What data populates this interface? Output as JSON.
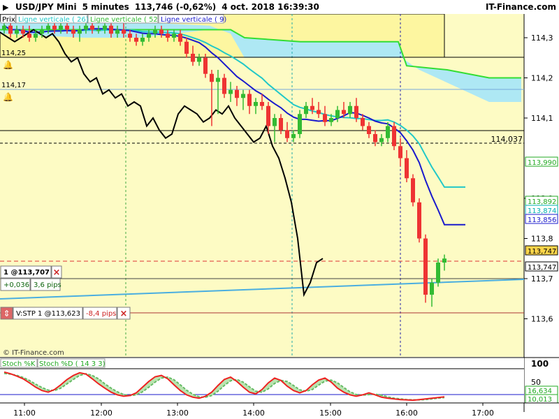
{
  "header": {
    "title": "USD/JPY Mini",
    "interval": "5 minutes",
    "quote": "113,746 (-0,62%)",
    "datetime": "4 oct. 2018 16:39:30",
    "brand": "IT-Finance.com"
  },
  "legend": {
    "price": "Prix",
    "line26": "Ligne verticale ( 26)",
    "line52": "Ligne verticale ( 52)",
    "line9": "Ligne verticale ( 9)"
  },
  "watermark": "© IT-Finance.com",
  "levels": {
    "alert_upper": "114,25",
    "alert_lower": "114,17",
    "dashed_level": "114,037"
  },
  "right_axis": {
    "ticks": [
      "114,3",
      "114,2",
      "114,1",
      "113,9",
      "113,8",
      "113,7",
      "113,6"
    ],
    "tags": [
      {
        "text": "113,990",
        "color": "#22aa22"
      },
      {
        "text": "113,892",
        "color": "#22aa22"
      },
      {
        "text": "113,874",
        "color": "#00b0b0"
      },
      {
        "text": "113,856",
        "color": "#1a1acc"
      },
      {
        "text": "113,747",
        "color": "#000000"
      },
      {
        "text": "113,747",
        "color": "#000000"
      }
    ]
  },
  "position": {
    "label": "1 @113,707",
    "gain": "+0,036",
    "pips": "3,6 pips",
    "close_icon": "×"
  },
  "stop": {
    "label": "V:STP  1 @113,623",
    "pips": "-8,4 pips",
    "close_icon": "×",
    "arrow_icon": "⇕"
  },
  "stoch": {
    "label_k": "Stoch %K",
    "label_d": "Stoch %D ( 14 3 3)",
    "ticks": [
      "100",
      "50"
    ],
    "tags": [
      {
        "text": "16,634",
        "color": "#22aa22"
      },
      {
        "text": "10,013",
        "color": "#22aa22"
      }
    ]
  },
  "x_axis": [
    "11:00",
    "12:00",
    "13:00",
    "14:00",
    "15:00",
    "16:00",
    "17:00"
  ],
  "chart_data": {
    "type": "candlestick",
    "ylim": [
      113.55,
      114.35
    ],
    "stoch_ylim": [
      0,
      100
    ],
    "x_labels": [
      "11:00",
      "12:00",
      "13:00",
      "14:00",
      "15:00",
      "16:00",
      "17:00"
    ],
    "candles": [
      [
        114.32,
        114.34,
        114.31,
        114.33
      ],
      [
        114.33,
        114.34,
        114.3,
        114.31
      ],
      [
        114.31,
        114.33,
        114.3,
        114.32
      ],
      [
        114.32,
        114.33,
        114.3,
        114.31
      ],
      [
        114.31,
        114.33,
        114.29,
        114.3
      ],
      [
        114.3,
        114.32,
        114.29,
        114.31
      ],
      [
        114.31,
        114.33,
        114.3,
        114.32
      ],
      [
        114.32,
        114.34,
        114.31,
        114.33
      ],
      [
        114.33,
        114.34,
        114.31,
        114.32
      ],
      [
        114.32,
        114.34,
        114.31,
        114.33
      ],
      [
        114.33,
        114.34,
        114.31,
        114.32
      ],
      [
        114.32,
        114.33,
        114.3,
        114.31
      ],
      [
        114.31,
        114.33,
        114.29,
        114.32
      ],
      [
        114.32,
        114.34,
        114.31,
        114.33
      ],
      [
        114.33,
        114.34,
        114.31,
        114.32
      ],
      [
        114.32,
        114.33,
        114.31,
        114.32
      ],
      [
        114.32,
        114.34,
        114.31,
        114.33
      ],
      [
        114.33,
        114.34,
        114.3,
        114.31
      ],
      [
        114.31,
        114.33,
        114.3,
        114.32
      ],
      [
        114.32,
        114.34,
        114.3,
        114.31
      ],
      [
        114.31,
        114.32,
        114.29,
        114.3
      ],
      [
        114.3,
        114.31,
        114.28,
        114.29
      ],
      [
        114.29,
        114.31,
        114.28,
        114.3
      ],
      [
        114.3,
        114.32,
        114.29,
        114.31
      ],
      [
        114.31,
        114.33,
        114.3,
        114.32
      ],
      [
        114.32,
        114.33,
        114.3,
        114.31
      ],
      [
        114.31,
        114.32,
        114.29,
        114.3
      ],
      [
        114.3,
        114.32,
        114.29,
        114.31
      ],
      [
        114.31,
        114.32,
        114.28,
        114.29
      ],
      [
        114.29,
        114.3,
        114.25,
        114.26
      ],
      [
        114.26,
        114.28,
        114.23,
        114.24
      ],
      [
        114.24,
        114.26,
        114.23,
        114.25
      ],
      [
        114.25,
        114.26,
        114.2,
        114.21
      ],
      [
        114.21,
        114.22,
        114.08,
        114.19
      ],
      [
        114.19,
        114.22,
        114.11,
        114.2
      ],
      [
        114.2,
        114.21,
        114.15,
        114.16
      ],
      [
        114.16,
        114.19,
        114.14,
        114.17
      ],
      [
        114.17,
        114.18,
        114.13,
        114.15
      ],
      [
        114.15,
        114.17,
        114.12,
        114.16
      ],
      [
        114.16,
        114.17,
        114.11,
        114.13
      ],
      [
        114.13,
        114.15,
        114.11,
        114.14
      ],
      [
        114.14,
        114.16,
        114.12,
        114.13
      ],
      [
        114.13,
        114.14,
        114.06,
        114.08
      ],
      [
        114.08,
        114.11,
        114.04,
        114.1
      ],
      [
        114.1,
        114.11,
        114.06,
        114.07
      ],
      [
        114.07,
        114.09,
        114.04,
        114.05
      ],
      [
        114.05,
        114.07,
        114.04,
        114.06
      ],
      [
        114.06,
        114.12,
        114.05,
        114.11
      ],
      [
        114.11,
        114.14,
        114.1,
        114.13
      ],
      [
        114.13,
        114.15,
        114.11,
        114.12
      ],
      [
        114.12,
        114.14,
        114.1,
        114.11
      ],
      [
        114.11,
        114.13,
        114.08,
        114.09
      ],
      [
        114.09,
        114.11,
        114.08,
        114.1
      ],
      [
        114.1,
        114.13,
        114.09,
        114.12
      ],
      [
        114.12,
        114.14,
        114.1,
        114.11
      ],
      [
        114.11,
        114.14,
        114.1,
        114.13
      ],
      [
        114.13,
        114.15,
        114.09,
        114.1
      ],
      [
        114.1,
        114.11,
        114.07,
        114.08
      ],
      [
        114.08,
        114.09,
        114.05,
        114.06
      ],
      [
        114.06,
        114.07,
        114.03,
        114.04
      ],
      [
        114.04,
        114.06,
        114.03,
        114.05
      ],
      [
        114.05,
        114.09,
        114.04,
        114.08
      ],
      [
        114.08,
        114.09,
        114.02,
        114.03
      ],
      [
        114.03,
        114.05,
        113.98,
        114.0
      ],
      [
        114.0,
        114.02,
        113.94,
        113.95
      ],
      [
        113.95,
        113.96,
        113.88,
        113.89
      ],
      [
        113.89,
        113.9,
        113.79,
        113.8
      ],
      [
        113.8,
        113.81,
        113.64,
        113.66
      ],
      [
        113.66,
        113.7,
        113.63,
        113.69
      ],
      [
        113.69,
        113.75,
        113.68,
        113.74
      ],
      [
        113.74,
        113.76,
        113.72,
        113.75
      ]
    ],
    "stoch_k": [
      90,
      85,
      78,
      70,
      58,
      45,
      35,
      30,
      38,
      52,
      68,
      80,
      88,
      84,
      70,
      55,
      42,
      30,
      22,
      18,
      20,
      28,
      45,
      62,
      76,
      80,
      70,
      52,
      35,
      22,
      15,
      12,
      18,
      30,
      50,
      68,
      75,
      62,
      45,
      30,
      25,
      38,
      58,
      72,
      65,
      48,
      35,
      28,
      35,
      52,
      66,
      72,
      60,
      42,
      30,
      22,
      18,
      22,
      28,
      22,
      15,
      12,
      10,
      8,
      7,
      6,
      8,
      10,
      12,
      14,
      16
    ],
    "stoch_d": [
      86,
      84,
      80,
      74,
      65,
      54,
      44,
      36,
      35,
      42,
      55,
      68,
      80,
      85,
      80,
      70,
      55,
      42,
      31,
      23,
      20,
      22,
      31,
      45,
      60,
      72,
      75,
      67,
      52,
      36,
      24,
      16,
      15,
      20,
      33,
      50,
      64,
      68,
      60,
      46,
      33,
      30,
      40,
      56,
      65,
      62,
      50,
      37,
      33,
      38,
      51,
      63,
      66,
      58,
      44,
      31,
      23,
      21,
      23,
      24,
      21,
      16,
      12,
      10,
      8,
      7,
      7,
      8,
      10,
      12,
      14
    ]
  }
}
